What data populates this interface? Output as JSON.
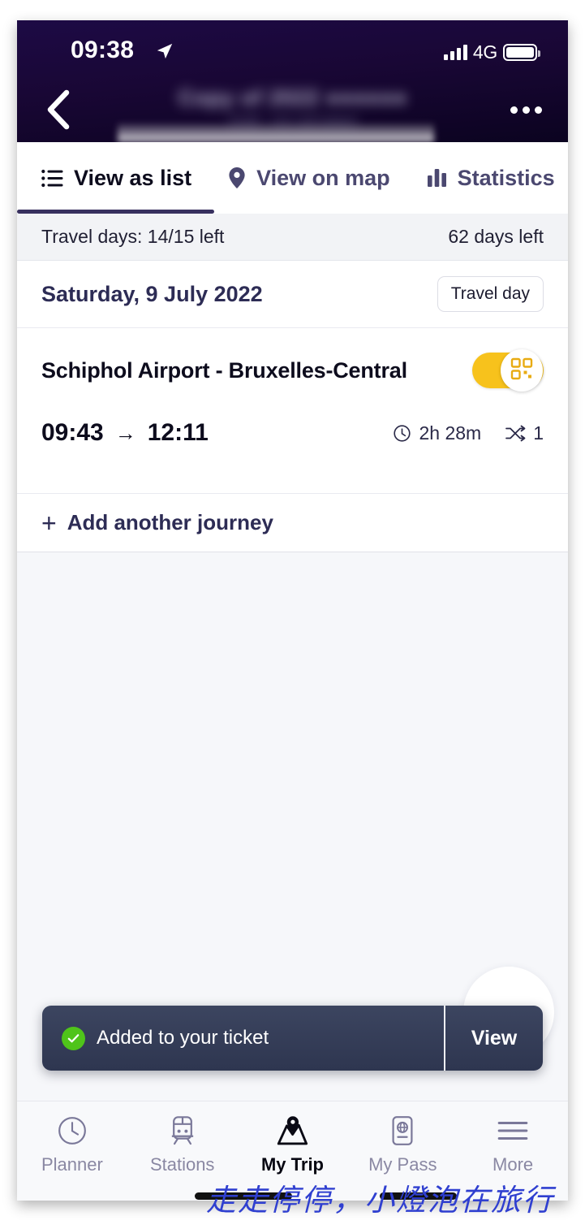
{
  "status_bar": {
    "time": "09:38",
    "location_icon": "location-arrow-icon",
    "network": "4G",
    "signal_icon": "signal-bars-icon",
    "battery_icon": "battery-full-icon"
  },
  "header": {
    "back_icon": "back-chevron-icon",
    "title_redacted": "Copy of 2022 ●●●●●●",
    "subtitle_redacted": "Draft - not calculated",
    "more_icon": "more-options-icon",
    "background_color": "#190735"
  },
  "tabs": [
    {
      "label": "View as list",
      "icon": "list-icon",
      "active": true
    },
    {
      "label": "View on map",
      "icon": "map-pin-icon",
      "active": false
    },
    {
      "label": "Statistics",
      "icon": "bar-chart-icon",
      "active": false
    }
  ],
  "travel_days_bar": {
    "left": "Travel days: 14/15 left",
    "right": "62 days left"
  },
  "date_section": {
    "date": "Saturday, 9 July 2022",
    "badge": "Travel day"
  },
  "journey": {
    "route": "Schiphol Airport - Bruxelles-Central",
    "depart_time": "09:43",
    "arrow": "→",
    "arrive_time": "12:11",
    "duration": "2h 28m",
    "duration_icon": "clock-icon",
    "transfers": "1",
    "transfers_icon": "transfer-icon",
    "ticket_toggle": {
      "state": "on",
      "icon": "qr-code-icon",
      "track_color": "#F7C21C"
    }
  },
  "add_journey": {
    "plus": "+",
    "label": "Add another journey"
  },
  "toast": {
    "message": "Added to your ticket",
    "status_icon": "check-circle-icon",
    "status_color": "#4FC41A",
    "action_label": "View",
    "background_color": "#333B55"
  },
  "bottom_nav": [
    {
      "label": "Planner",
      "icon": "clock-icon",
      "active": false
    },
    {
      "label": "Stations",
      "icon": "train-icon",
      "active": false
    },
    {
      "label": "My Trip",
      "icon": "trip-map-pin-icon",
      "active": true
    },
    {
      "label": "My Pass",
      "icon": "pass-phone-icon",
      "active": false
    },
    {
      "label": "More",
      "icon": "hamburger-menu-icon",
      "active": false
    }
  ],
  "watermark": {
    "text": "走走停停，小燈泡在旅行",
    "color": "#2f3fd0"
  }
}
